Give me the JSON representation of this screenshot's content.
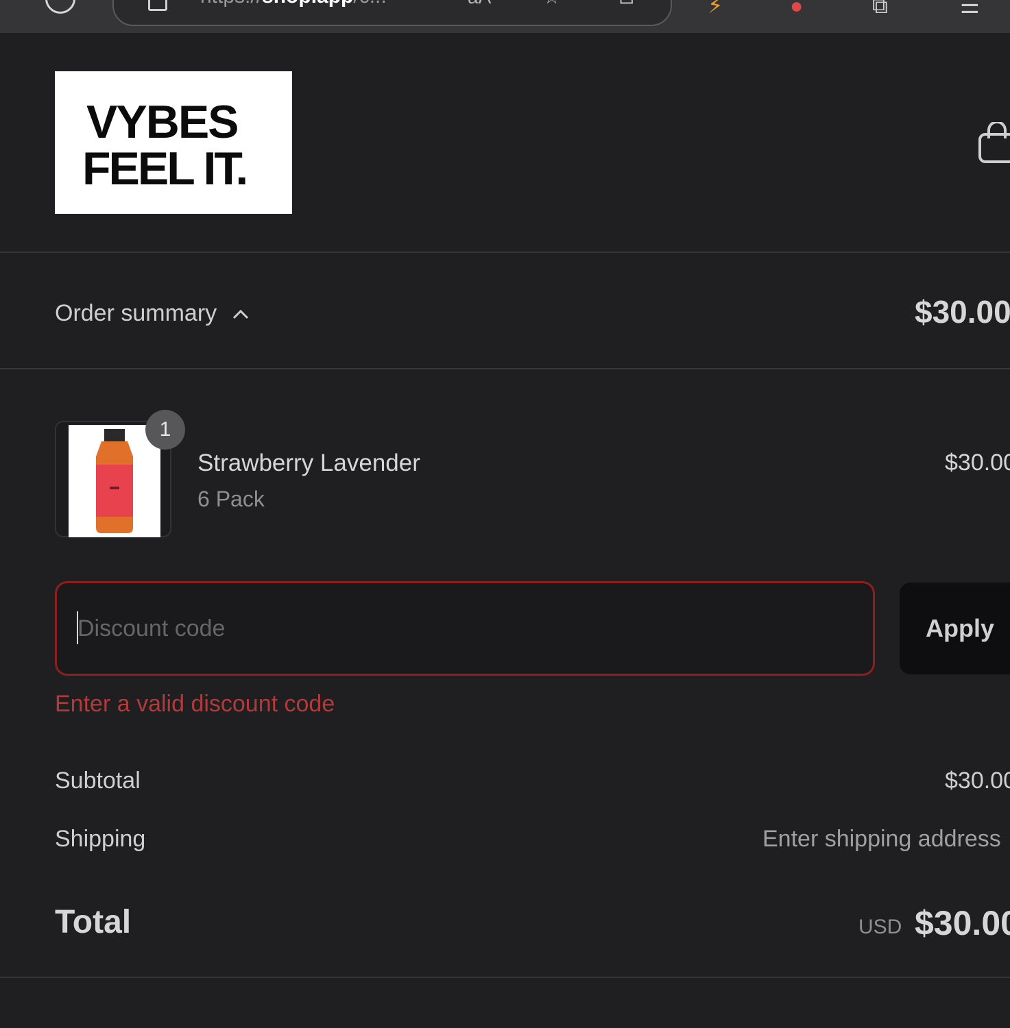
{
  "browser": {
    "url_scheme": "https://",
    "url_host": "shop.app",
    "url_rest": "/c...",
    "read_aloud_label": "aA",
    "icons": [
      "reload-icon",
      "lock-icon",
      "read-aloud-icon",
      "favorites-star-icon",
      "bookmark-icon",
      "extension-icon",
      "collections-icon",
      "favorites-bar-icon"
    ]
  },
  "header": {
    "logo_line1": "VYBES",
    "logo_line2": "FEEL IT.",
    "cart_icon": "shopping-bag-icon"
  },
  "summary": {
    "label": "Order summary",
    "total": "$30.00"
  },
  "line_item": {
    "quantity": "1",
    "name": "Strawberry Lavender",
    "variant": "6 Pack",
    "price": "$30.00"
  },
  "discount": {
    "placeholder": "Discount code",
    "value": "",
    "apply_label": "Apply",
    "error": "Enter a valid discount code",
    "error_color": "#b23a3a"
  },
  "totals": {
    "subtotal_label": "Subtotal",
    "subtotal_value": "$30.00",
    "shipping_label": "Shipping",
    "shipping_value": "Enter shipping address",
    "total_label": "Total",
    "currency": "USD",
    "total_value": "$30.00"
  }
}
